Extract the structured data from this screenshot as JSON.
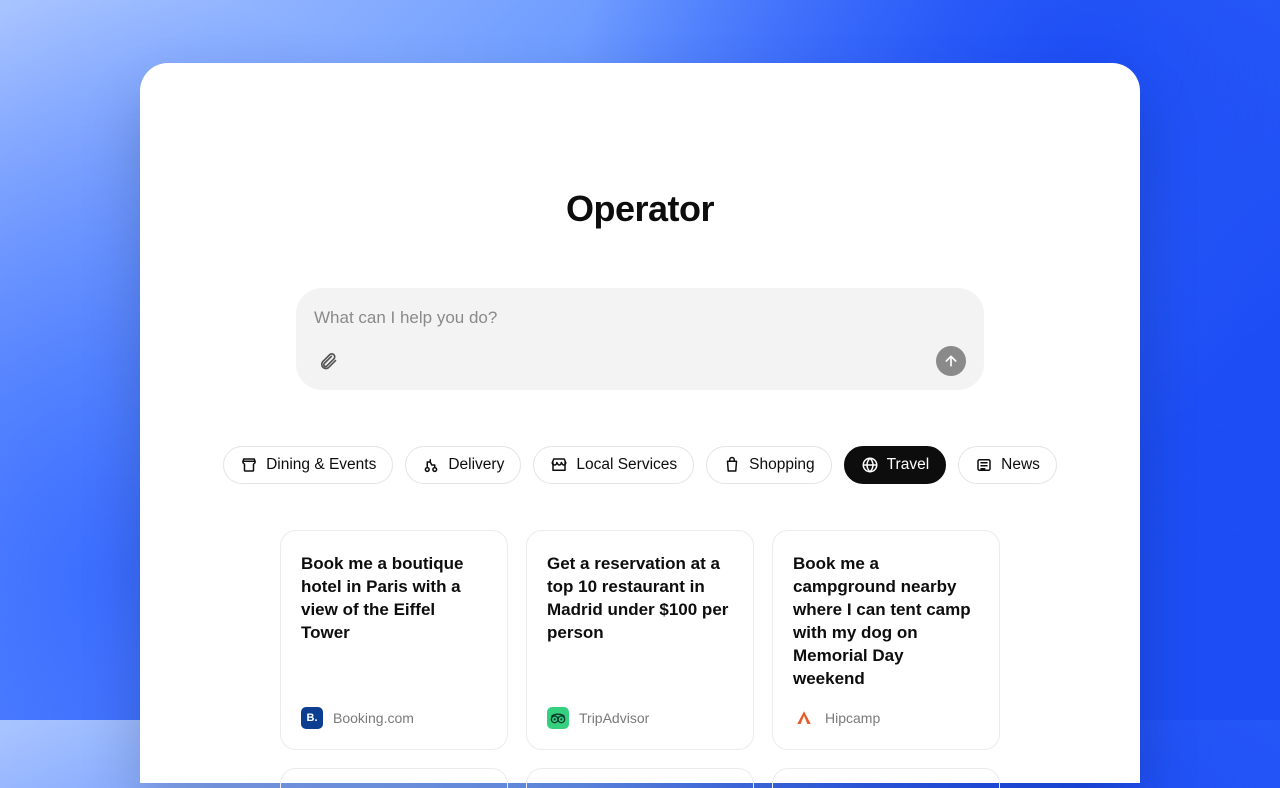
{
  "title": "Operator",
  "input": {
    "placeholder": "What can I help you do?",
    "value": ""
  },
  "chips": [
    {
      "label": "Dining & Events",
      "icon": "map-pin-icon",
      "active": false
    },
    {
      "label": "Delivery",
      "icon": "delivery-icon",
      "active": false
    },
    {
      "label": "Local Services",
      "icon": "storefront-icon",
      "active": false
    },
    {
      "label": "Shopping",
      "icon": "shopping-bag-icon",
      "active": false
    },
    {
      "label": "Travel",
      "icon": "globe-icon",
      "active": true
    },
    {
      "label": "News",
      "icon": "newspaper-icon",
      "active": false
    }
  ],
  "cards": [
    {
      "title": "Book me a boutique hotel in Paris with a view of the Eiffel Tower",
      "provider": {
        "name": "Booking.com",
        "icon_letter": "B.",
        "bg": "#0b3e91"
      }
    },
    {
      "title": "Get a reservation at a top 10 restaurant in Madrid under $100 per person",
      "provider": {
        "name": "TripAdvisor",
        "icon_letter": "",
        "bg": "#35d07f"
      }
    },
    {
      "title": "Book me a campground nearby where I can tent camp with my dog on Memorial Day weekend",
      "provider": {
        "name": "Hipcamp",
        "icon_letter": "",
        "bg": "#ffffff"
      }
    }
  ]
}
